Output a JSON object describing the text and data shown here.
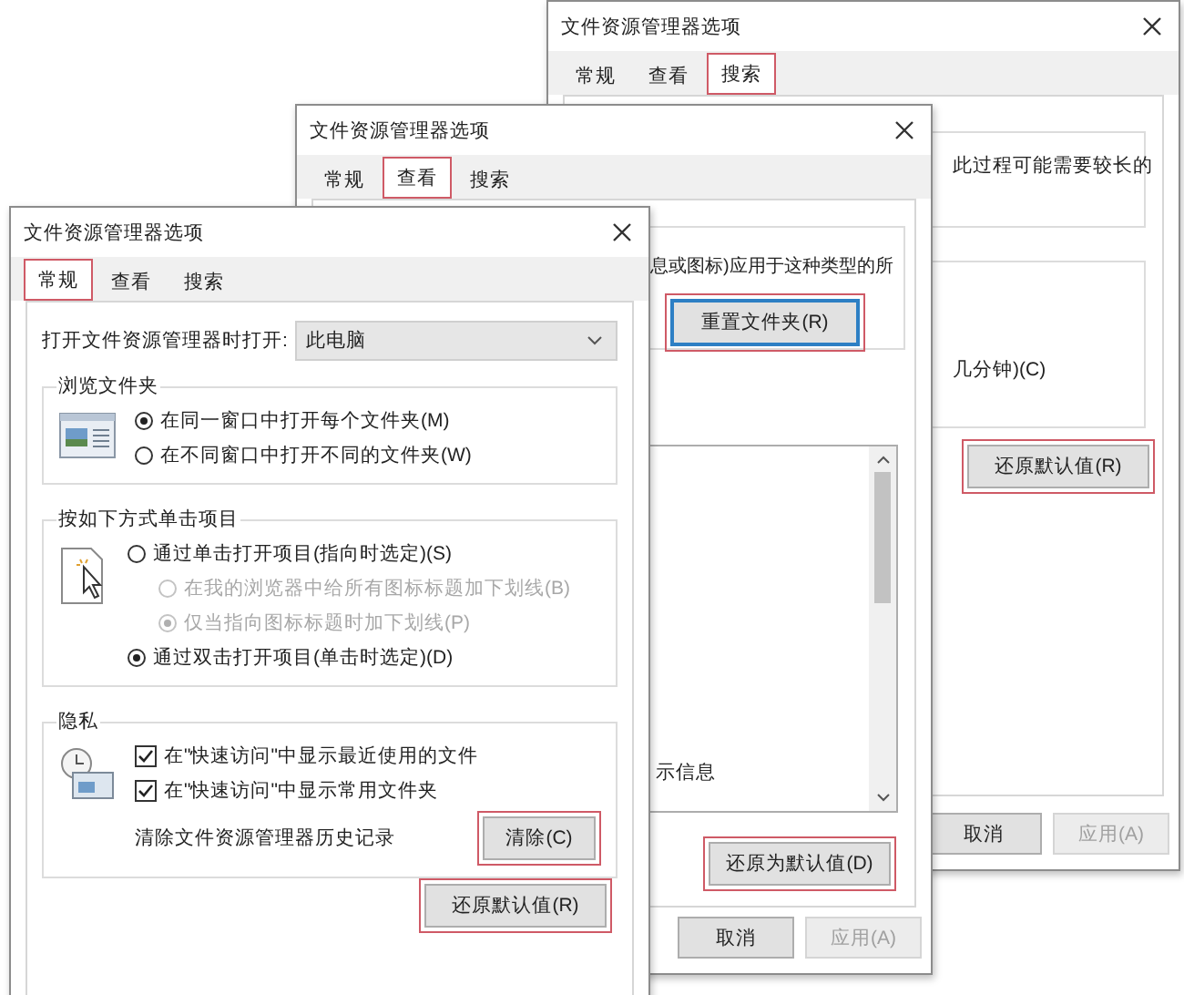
{
  "windows": [
    {
      "kind": "search",
      "title": "文件资源管理器选项",
      "tabs": [
        {
          "label": "常规",
          "selected": false,
          "highlighted": false
        },
        {
          "label": "查看",
          "selected": false,
          "highlighted": false
        },
        {
          "label": "搜索",
          "selected": true,
          "highlighted": true
        }
      ],
      "notes": [
        "此过程可能需要较长的",
        "几分钟)(C)"
      ],
      "restore_button": {
        "label": "还原默认值(R)",
        "highlighted": true
      },
      "footer_buttons": [
        {
          "label": "取消",
          "disabled": false
        },
        {
          "label": "应用(A)",
          "disabled": true
        }
      ]
    },
    {
      "kind": "view",
      "title": "文件资源管理器选项",
      "tabs": [
        {
          "label": "常规",
          "selected": false,
          "highlighted": false
        },
        {
          "label": "查看",
          "selected": true,
          "highlighted": true
        },
        {
          "label": "搜索",
          "selected": false,
          "highlighted": false
        }
      ],
      "folder_views_text": "息或图标)应用于这种类型的所",
      "reset_button": {
        "label": "重置文件夹(R)",
        "highlighted": true,
        "focused": true
      },
      "advanced_list": [
        "示信息"
      ],
      "restore_button": {
        "label": "还原为默认值(D)",
        "highlighted": true
      },
      "footer_buttons": [
        {
          "label": "取消",
          "disabled": false
        },
        {
          "label": "应用(A)",
          "disabled": true
        }
      ]
    },
    {
      "kind": "general",
      "title": "文件资源管理器选项",
      "tabs": [
        {
          "label": "常规",
          "selected": true,
          "highlighted": true
        },
        {
          "label": "查看",
          "selected": false,
          "highlighted": false
        },
        {
          "label": "搜索",
          "selected": false,
          "highlighted": false
        }
      ],
      "open_in": {
        "label": "打开文件资源管理器时打开:",
        "value": "此电脑"
      },
      "groups": [
        {
          "kind": "radios",
          "title": "浏览文件夹",
          "options": [
            {
              "label": "在同一窗口中打开每个文件夹(M)",
              "selected": true,
              "disabled": false
            },
            {
              "label": "在不同窗口中打开不同的文件夹(W)",
              "selected": false,
              "disabled": false
            }
          ]
        },
        {
          "kind": "radios",
          "title": "按如下方式单击项目",
          "options": [
            {
              "label": "通过单击打开项目(指向时选定)(S)",
              "selected": false,
              "disabled": false,
              "children": [
                {
                  "label": "在我的浏览器中给所有图标标题加下划线(B)",
                  "selected": false,
                  "disabled": true
                },
                {
                  "label": "仅当指向图标标题时加下划线(P)",
                  "selected": true,
                  "disabled": true
                }
              ]
            },
            {
              "label": "通过双击打开项目(单击时选定)(D)",
              "selected": true,
              "disabled": false
            }
          ]
        },
        {
          "kind": "privacy",
          "title": "隐私",
          "checkboxes": [
            {
              "label": "在\"快速访问\"中显示最近使用的文件",
              "checked": true
            },
            {
              "label": "在\"快速访问\"中显示常用文件夹",
              "checked": true
            }
          ],
          "clear_label": "清除文件资源管理器历史记录",
          "clear_button": {
            "label": "清除(C)",
            "highlighted": true
          }
        }
      ],
      "restore_button": {
        "label": "还原默认值(R)",
        "highlighted": true
      }
    }
  ]
}
